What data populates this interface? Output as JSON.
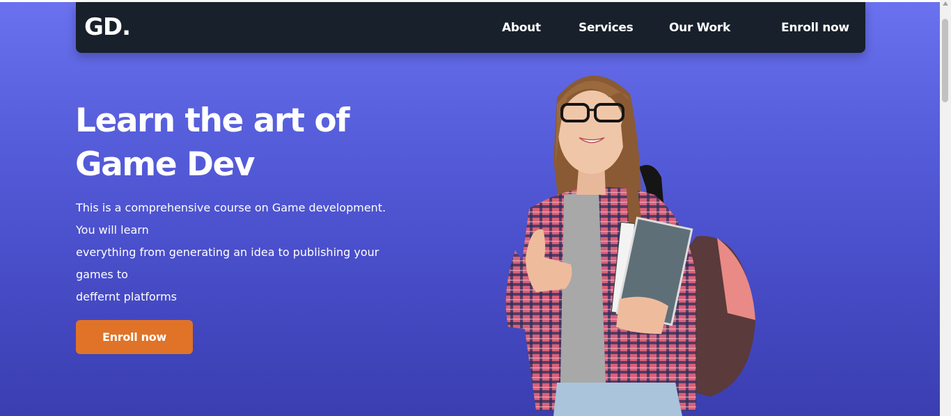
{
  "nav": {
    "logo": "GD.",
    "links": [
      "About",
      "Services",
      "Our Work",
      "Enroll now"
    ]
  },
  "hero": {
    "headline_line1": "Learn the art of",
    "headline_line2": "Game Dev",
    "description_lines": [
      "This is a comprehensive course on Game development.",
      "You will learn",
      "everything from generating an idea to publishing your",
      "games to",
      "deffernt platforms"
    ],
    "cta_label": "Enroll now",
    "image_alt": "student holding books giving thumbs up"
  },
  "colors": {
    "navbar_bg": "#17202b",
    "hero_gradient_top": "#6b72f0",
    "hero_gradient_bottom": "#3a3eb0",
    "cta_bg": "#e07328",
    "text": "#ffffff"
  }
}
